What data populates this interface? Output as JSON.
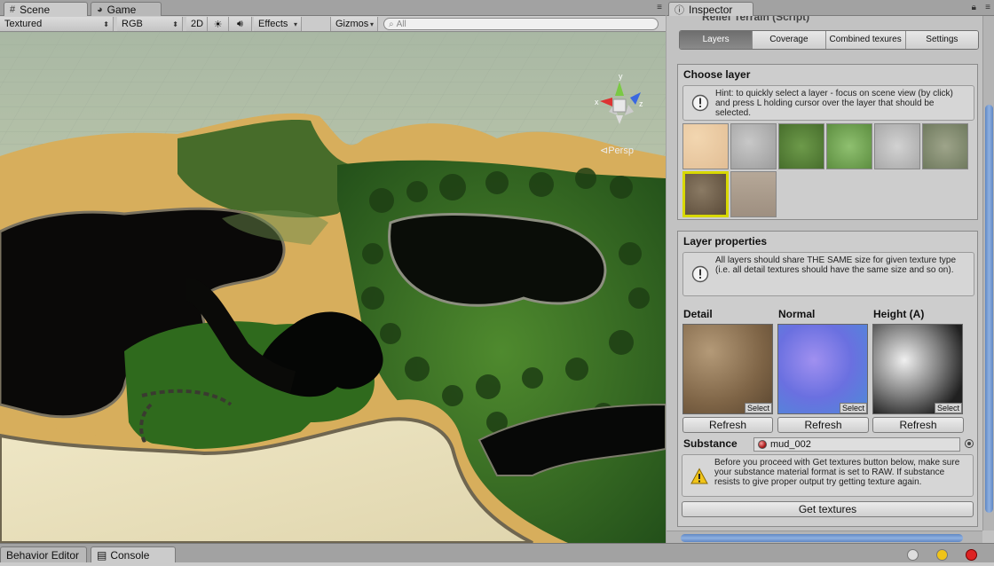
{
  "scene_tabs": [
    {
      "label": "Scene",
      "icon": "grid-icon"
    },
    {
      "label": "Game",
      "icon": "pacman-icon"
    }
  ],
  "scene_toolbar": {
    "shading_mode": "Textured",
    "render_mode": "RGB",
    "btn_2d": "2D",
    "effects": "Effects",
    "gizmos": "Gizmos",
    "search_placeholder": "All"
  },
  "viewport": {
    "persp_label": "Persp",
    "gizmo_y": "y",
    "gizmo_x": "x",
    "gizmo_z": "z"
  },
  "inspector": {
    "tab_label": "Inspector",
    "component_title": "Relief Terrain (Script)",
    "toolbar": [
      {
        "label": "Layers",
        "active": true
      },
      {
        "label": "Coverage",
        "active": false
      },
      {
        "label": "Combined texures",
        "active": false
      },
      {
        "label": "Settings",
        "active": false
      }
    ],
    "choose_layer": {
      "title": "Choose layer",
      "hint": "Hint: to quickly select a layer - focus on scene view (by click) and press L holding cursor over the layer that should be selected."
    },
    "layer_properties": {
      "title": "Layer properties",
      "info": "All layers should share THE SAME size for given texture type\n(i.e. all detail textures should have the same size and so on).",
      "detail_label": "Detail",
      "normal_label": "Normal",
      "height_label": "Height (A)",
      "select_label": "Select",
      "refresh_label": "Refresh",
      "substance_label": "Substance",
      "substance_value": "mud_002",
      "warning": "Before you proceed with Get textures button below, make sure your substance material format is set to RAW. If substance resists to give proper output try getting texture again.",
      "get_textures": "Get textures"
    }
  },
  "bottom_tabs": [
    {
      "label": "Behavior Editor",
      "icon": ""
    },
    {
      "label": "Console",
      "icon": "console-icon"
    }
  ],
  "colors": {
    "accent_blue": "#5f87c4",
    "selection_yellow": "#d8d800"
  }
}
